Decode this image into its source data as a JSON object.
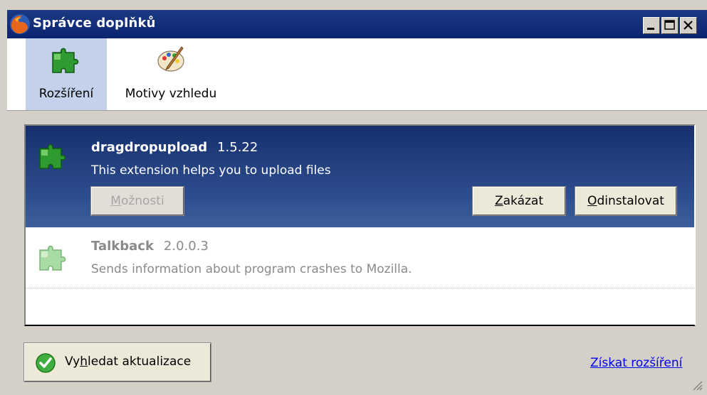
{
  "window": {
    "title": "Správce doplňků",
    "controls": [
      "minimize-icon",
      "maximize-icon",
      "close-icon"
    ]
  },
  "toolbar": {
    "tabs": [
      {
        "label": "Rozšíření",
        "icon": "extension-puzzle-icon",
        "selected": true
      },
      {
        "label": "Motivy vzhledu",
        "icon": "theme-palette-icon",
        "selected": false
      }
    ]
  },
  "extensions": [
    {
      "name": "dragdropupload",
      "version": "1.5.22",
      "description": "This extension helps you to upload files",
      "selected": true,
      "buttons": {
        "options": {
          "pre": "",
          "key": "M",
          "post": "ožnosti",
          "enabled": false
        },
        "disable": {
          "pre": "",
          "key": "Z",
          "post": "akázat",
          "enabled": true
        },
        "uninstall": {
          "pre": "",
          "key": "O",
          "post": "dinstalovat",
          "enabled": true
        }
      }
    },
    {
      "name": "Talkback",
      "version": "2.0.0.3",
      "description": "Sends information about program crashes to Mozilla.",
      "selected": false,
      "disabled": true
    }
  ],
  "footer": {
    "update_button": {
      "pre": "Vy",
      "key": "h",
      "post": "ledat aktualizace"
    },
    "get_more_link": "Získat rozšíření"
  },
  "colors": {
    "titlebar": "#0c2470",
    "selection": "#2e4d8f",
    "link": "#0000ee"
  }
}
